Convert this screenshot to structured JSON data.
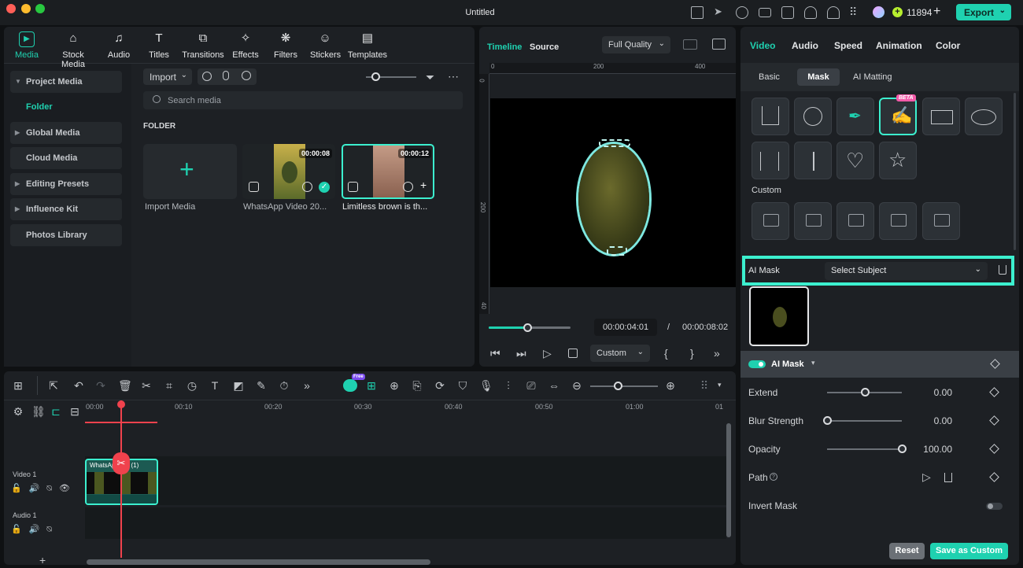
{
  "window": {
    "title": "Untitled",
    "credits": "11894",
    "export_label": "Export"
  },
  "colors": {
    "accent": "#1fd1b0",
    "accent_border": "#3cf0cf",
    "playhead": "#f0424d",
    "beta": "#f45ba9"
  },
  "toolbar": {
    "items": [
      {
        "label": "Media",
        "icon": "media-icon"
      },
      {
        "label": "Stock Media",
        "icon": "stock-media-icon"
      },
      {
        "label": "Audio",
        "icon": "audio-icon"
      },
      {
        "label": "Titles",
        "icon": "titles-icon"
      },
      {
        "label": "Transitions",
        "icon": "transitions-icon"
      },
      {
        "label": "Effects",
        "icon": "effects-icon"
      },
      {
        "label": "Filters",
        "icon": "filters-icon"
      },
      {
        "label": "Stickers",
        "icon": "stickers-icon"
      },
      {
        "label": "Templates",
        "icon": "templates-icon"
      }
    ]
  },
  "sidebar": {
    "items": [
      {
        "label": "Project Media"
      },
      {
        "label": "Folder"
      },
      {
        "label": "Global Media"
      },
      {
        "label": "Cloud Media"
      },
      {
        "label": "Editing Presets"
      },
      {
        "label": "Influence Kit"
      },
      {
        "label": "Photos Library"
      }
    ]
  },
  "media": {
    "import_label": "Import",
    "search_placeholder": "Search media",
    "folder_heading": "FOLDER",
    "items": [
      {
        "label": "Import Media"
      },
      {
        "label": "WhatsApp Video 20...",
        "duration": "00:00:08"
      },
      {
        "label": "Limitless brown is th...",
        "duration": "00:00:12"
      }
    ]
  },
  "preview": {
    "tab_timeline": "Timeline",
    "tab_source": "Source",
    "quality": "Full Quality",
    "ruler": [
      "0",
      "200",
      "400"
    ],
    "vruler": [
      "0",
      "200",
      "40"
    ],
    "current_time": "00:00:04:01",
    "separator": "/",
    "total_time": "00:00:08:02",
    "progress": 0.47,
    "speed": "Custom"
  },
  "properties": {
    "tabs": [
      "Video",
      "Audio",
      "Speed",
      "Animation",
      "Color"
    ],
    "subtabs": [
      "Basic",
      "Mask",
      "AI Matting"
    ],
    "beta_label": "BETA",
    "custom_label": "Custom",
    "ai_mask_label": "AI Mask",
    "ai_mask_select": "Select Subject",
    "section_title": "AI Mask",
    "extend": {
      "label": "Extend",
      "value": "0.00",
      "level": 0.5
    },
    "blur": {
      "label": "Blur Strength",
      "value": "0.00",
      "level": 0.0
    },
    "opacity": {
      "label": "Opacity",
      "value": "100.00",
      "level": 1.0
    },
    "path_label": "Path",
    "invert_label": "Invert Mask",
    "reset_label": "Reset",
    "save_label": "Save as Custom"
  },
  "timeline": {
    "ruler": [
      "00:00",
      "00:10",
      "00:20",
      "00:30",
      "00:40",
      "00:50",
      "01:00",
      "01"
    ],
    "track_video": "Video 1",
    "track_audio": "Audio 1",
    "clip_label": "WhatsApp...M (1)",
    "free_badge": "Free"
  }
}
